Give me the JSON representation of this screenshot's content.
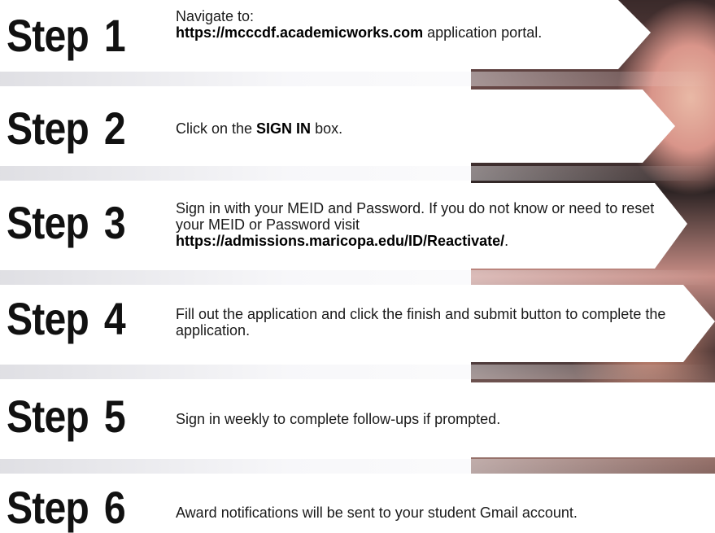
{
  "steps": [
    {
      "word": "Step",
      "num": "1",
      "text": {
        "pre": "Navigate to:",
        "bold": "https://mcccdf.academicworks.com",
        "post": " application portal."
      }
    },
    {
      "word": "Step",
      "num": "2",
      "text": {
        "pre": "Click on the ",
        "bold": "SIGN IN",
        "post": " box."
      }
    },
    {
      "word": "Step",
      "num": "3",
      "text": {
        "pre": "Sign in with your MEID and Password. If you do not know or need to reset your MEID or Password visit",
        "bold": "https://admissions.maricopa.edu/ID/Reactivate/",
        "post": "."
      }
    },
    {
      "word": "Step",
      "num": "4",
      "text": {
        "pre": "Fill out the application and click the finish and submit button to complete the application."
      }
    },
    {
      "word": "Step",
      "num": "5",
      "text": {
        "pre": "Sign in weekly to complete follow-ups if prompted."
      }
    },
    {
      "word": "Step",
      "num": "6",
      "text": {
        "pre": "Award notifications will be sent to your student Gmail account."
      }
    }
  ]
}
